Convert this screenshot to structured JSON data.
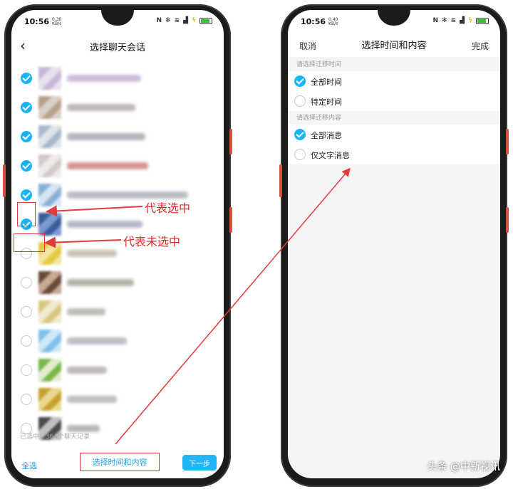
{
  "colors": {
    "accent": "#18b4f3",
    "annotation_red": "#e23b3b",
    "link_blue": "#1a9ce0"
  },
  "left_phone": {
    "status": {
      "time": "10:56",
      "speed_value": "0.30",
      "speed_unit": "KB/s"
    },
    "nav": {
      "back_icon": "back-chevron-icon",
      "title": "选择聊天会话"
    },
    "contacts": [
      {
        "checked": true
      },
      {
        "checked": true
      },
      {
        "checked": true
      },
      {
        "checked": true
      },
      {
        "checked": true
      },
      {
        "checked": true
      },
      {
        "checked": false
      },
      {
        "checked": false
      },
      {
        "checked": false
      },
      {
        "checked": false
      },
      {
        "checked": false
      },
      {
        "checked": false
      },
      {
        "checked": false
      }
    ],
    "footer": {
      "selected_label": "已选中:",
      "selected_count": "364个聊天记录",
      "select_all": "全选",
      "select_time_content": "选择时间和内容",
      "next": "下一步"
    }
  },
  "right_phone": {
    "status": {
      "time": "10:56",
      "speed_value": "0.40",
      "speed_unit": "KB/s"
    },
    "nav": {
      "cancel": "取消",
      "title": "选择时间和内容",
      "done": "完成"
    },
    "time_section": {
      "label": "请选择迁移时间",
      "options": [
        {
          "label": "全部时间",
          "checked": true
        },
        {
          "label": "特定时间",
          "checked": false
        }
      ]
    },
    "content_section": {
      "label": "请选择迁移内容",
      "options": [
        {
          "label": "全部消息",
          "checked": true
        },
        {
          "label": "仅文字消息",
          "checked": false
        }
      ]
    }
  },
  "annotations": {
    "selected": "代表选中",
    "unselected": "代表未选中"
  },
  "watermark": "头条 @中新视讯"
}
